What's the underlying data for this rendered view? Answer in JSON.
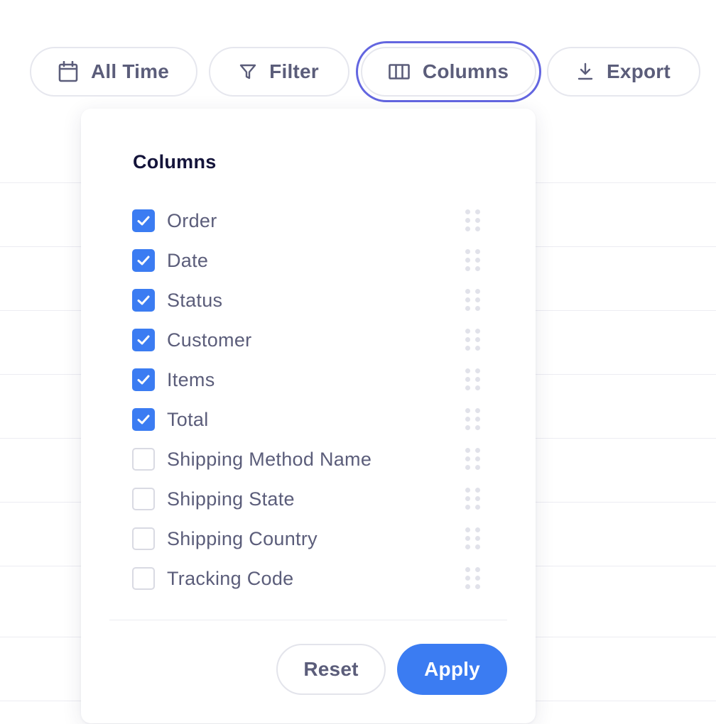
{
  "toolbar": {
    "all_time_label": "All Time",
    "filter_label": "Filter",
    "columns_label": "Columns",
    "export_label": "Export"
  },
  "columns_panel": {
    "title": "Columns",
    "items": [
      {
        "label": "Order",
        "checked": true
      },
      {
        "label": "Date",
        "checked": true
      },
      {
        "label": "Status",
        "checked": true
      },
      {
        "label": "Customer",
        "checked": true
      },
      {
        "label": "Items",
        "checked": true
      },
      {
        "label": "Total",
        "checked": true
      },
      {
        "label": "Shipping Method Name",
        "checked": false
      },
      {
        "label": "Shipping State",
        "checked": false
      },
      {
        "label": "Shipping Country",
        "checked": false
      },
      {
        "label": "Tracking Code",
        "checked": false
      }
    ],
    "reset_label": "Reset",
    "apply_label": "Apply"
  },
  "colors": {
    "accent": "#3b7cf2",
    "focus_ring": "#6366e0",
    "text": "#5b5d7a",
    "title": "#14143a"
  },
  "icons": {
    "all_time": "calendar-icon",
    "filter": "filter-icon",
    "columns": "columns-icon",
    "export": "download-icon",
    "check": "check-icon",
    "drag": "drag-handle-icon"
  }
}
